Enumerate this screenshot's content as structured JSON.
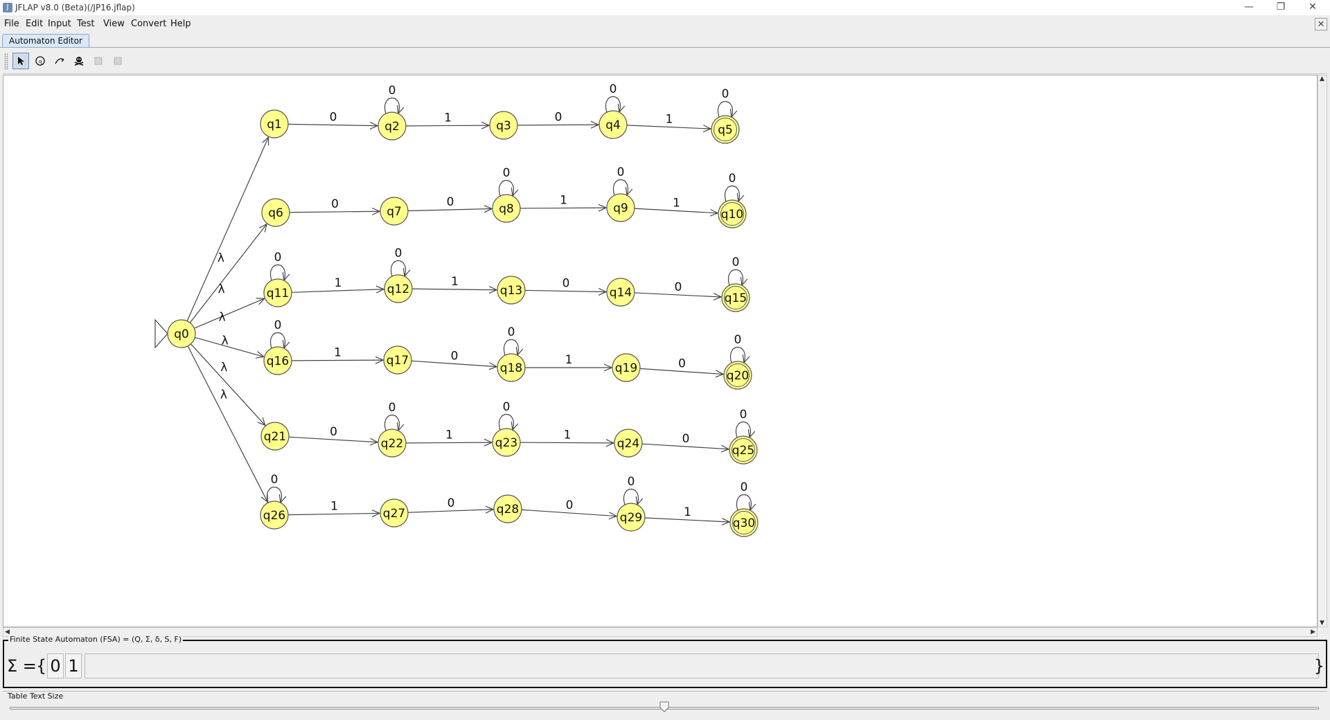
{
  "window": {
    "title": "JFLAP v8.0 (Beta)(/JP16.jflap)",
    "minimize_icon": "minimize-icon",
    "maximize_icon": "restore-icon",
    "close_icon": "close-icon"
  },
  "menu": [
    "File",
    "Edit",
    "Input",
    "Test",
    "View",
    "Convert",
    "Help"
  ],
  "tab": {
    "label": "Automaton Editor"
  },
  "toolbar": {
    "tools": [
      {
        "name": "attribute-editor-icon",
        "active": true
      },
      {
        "name": "state-creator-icon",
        "active": false
      },
      {
        "name": "transition-creator-icon",
        "active": false
      },
      {
        "name": "deleter-icon",
        "active": false
      },
      {
        "name": "undo-icon",
        "active": false
      },
      {
        "name": "redo-icon",
        "active": false
      }
    ]
  },
  "automaton": {
    "start": "q0",
    "colors": {
      "state_fill": "#ffff8c",
      "state_stroke": "#555555",
      "edge": "#444444"
    },
    "states": [
      "q0",
      "q1",
      "q2",
      "q3",
      "q4",
      "q5",
      "q6",
      "q7",
      "q8",
      "q9",
      "q10",
      "q11",
      "q12",
      "q13",
      "q14",
      "q15",
      "q16",
      "q17",
      "q18",
      "q19",
      "q20",
      "q21",
      "q22",
      "q23",
      "q24",
      "q25",
      "q26",
      "q27",
      "q28",
      "q29",
      "q30"
    ],
    "final_states": [
      "q5",
      "q10",
      "q15",
      "q20",
      "q25",
      "q30"
    ],
    "transitions": [
      {
        "from": "q0",
        "to": "q1",
        "label": "λ"
      },
      {
        "from": "q0",
        "to": "q6",
        "label": "λ"
      },
      {
        "from": "q0",
        "to": "q11",
        "label": "λ"
      },
      {
        "from": "q0",
        "to": "q16",
        "label": "λ"
      },
      {
        "from": "q0",
        "to": "q21",
        "label": "λ"
      },
      {
        "from": "q0",
        "to": "q26",
        "label": "λ"
      },
      {
        "from": "q1",
        "to": "q2",
        "label": "0"
      },
      {
        "from": "q2",
        "to": "q2",
        "label": "0"
      },
      {
        "from": "q2",
        "to": "q3",
        "label": "1"
      },
      {
        "from": "q3",
        "to": "q4",
        "label": "0"
      },
      {
        "from": "q4",
        "to": "q4",
        "label": "0"
      },
      {
        "from": "q4",
        "to": "q5",
        "label": "1"
      },
      {
        "from": "q5",
        "to": "q5",
        "label": "0"
      },
      {
        "from": "q6",
        "to": "q7",
        "label": "0"
      },
      {
        "from": "q7",
        "to": "q8",
        "label": "0"
      },
      {
        "from": "q8",
        "to": "q8",
        "label": "0"
      },
      {
        "from": "q8",
        "to": "q9",
        "label": "1"
      },
      {
        "from": "q9",
        "to": "q9",
        "label": "0"
      },
      {
        "from": "q9",
        "to": "q10",
        "label": "1"
      },
      {
        "from": "q10",
        "to": "q10",
        "label": "0"
      },
      {
        "from": "q11",
        "to": "q11",
        "label": "0"
      },
      {
        "from": "q11",
        "to": "q12",
        "label": "1"
      },
      {
        "from": "q12",
        "to": "q12",
        "label": "0"
      },
      {
        "from": "q12",
        "to": "q13",
        "label": "1"
      },
      {
        "from": "q13",
        "to": "q14",
        "label": "0"
      },
      {
        "from": "q14",
        "to": "q15",
        "label": "0"
      },
      {
        "from": "q15",
        "to": "q15",
        "label": "0"
      },
      {
        "from": "q16",
        "to": "q16",
        "label": "0"
      },
      {
        "from": "q16",
        "to": "q17",
        "label": "1"
      },
      {
        "from": "q17",
        "to": "q18",
        "label": "0"
      },
      {
        "from": "q18",
        "to": "q18",
        "label": "0"
      },
      {
        "from": "q18",
        "to": "q19",
        "label": "1"
      },
      {
        "from": "q19",
        "to": "q20",
        "label": "0"
      },
      {
        "from": "q20",
        "to": "q20",
        "label": "0"
      },
      {
        "from": "q21",
        "to": "q22",
        "label": "0"
      },
      {
        "from": "q22",
        "to": "q22",
        "label": "0"
      },
      {
        "from": "q22",
        "to": "q23",
        "label": "1"
      },
      {
        "from": "q23",
        "to": "q23",
        "label": "0"
      },
      {
        "from": "q23",
        "to": "q24",
        "label": "1"
      },
      {
        "from": "q24",
        "to": "q25",
        "label": "0"
      },
      {
        "from": "q25",
        "to": "q25",
        "label": "0"
      },
      {
        "from": "q26",
        "to": "q26",
        "label": "0"
      },
      {
        "from": "q26",
        "to": "q27",
        "label": "1"
      },
      {
        "from": "q27",
        "to": "q28",
        "label": "0"
      },
      {
        "from": "q28",
        "to": "q29",
        "label": "0"
      },
      {
        "from": "q29",
        "to": "q29",
        "label": "0"
      },
      {
        "from": "q29",
        "to": "q30",
        "label": "1"
      },
      {
        "from": "q30",
        "to": "q30",
        "label": "0"
      }
    ]
  },
  "fsa_panel": {
    "title": "Finite State Automaton (FSA) = (Q, Σ, δ, S, F)",
    "sigma_label": "Σ =",
    "open_brace": "{",
    "close_brace": "}",
    "symbols": [
      "0",
      "1"
    ]
  },
  "text_size": {
    "label": "Table Text Size",
    "level_fraction": 0.5
  }
}
